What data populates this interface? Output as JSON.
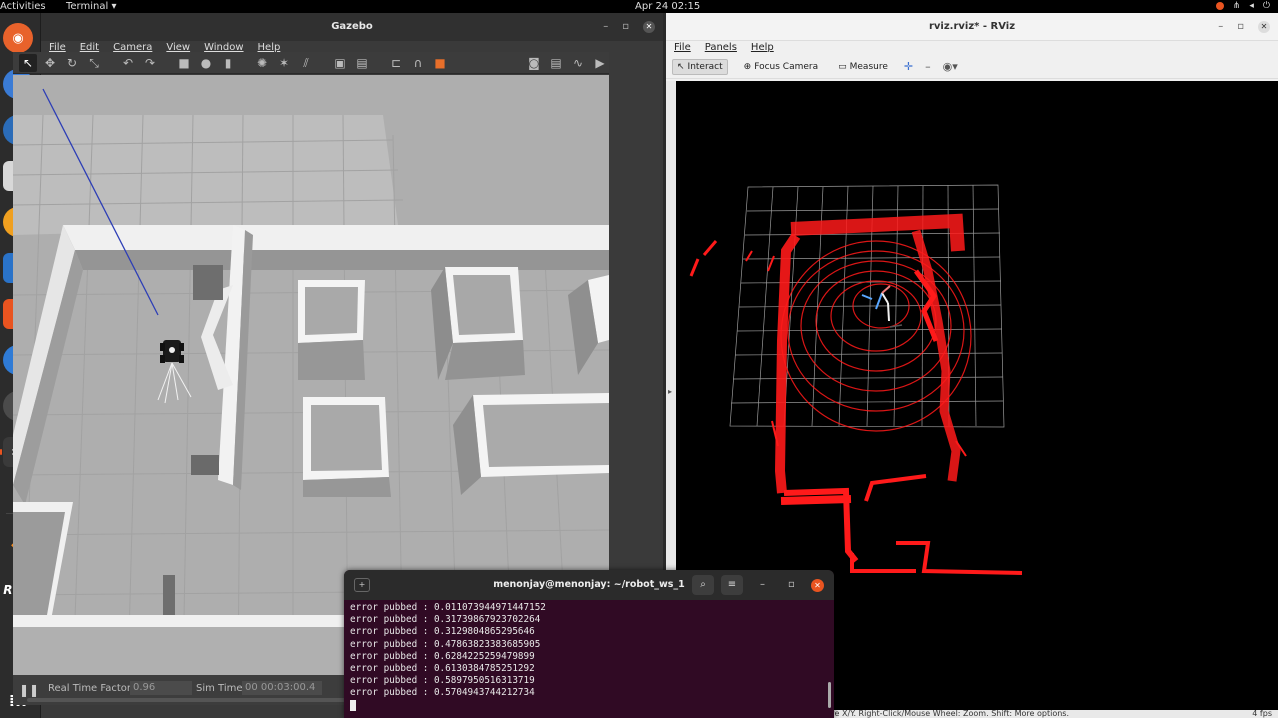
{
  "topbar": {
    "activities": "Activities",
    "app_menu": "Terminal ▾",
    "clock": "Apr 24  02:15",
    "tray_icons": [
      "network-icon",
      "volume-icon",
      "power-icon"
    ]
  },
  "dock": {
    "items": [
      {
        "name": "firefox-icon",
        "color": "#e8622b"
      },
      {
        "name": "chromium-icon",
        "color": "#3a7bd5"
      },
      {
        "name": "thunderbird-icon",
        "color": "#2b6cb8"
      },
      {
        "name": "files-icon",
        "color": "#d8d8d8"
      },
      {
        "name": "rhythmbox-icon",
        "color": "#f0a020"
      },
      {
        "name": "writer-icon",
        "color": "#2a73c9"
      },
      {
        "name": "software-icon",
        "color": "#e95420"
      },
      {
        "name": "help-icon",
        "color": "#2f7bd6"
      },
      {
        "name": "updater-icon",
        "color": "#4b4b4b"
      },
      {
        "name": "terminal-icon",
        "color": "#3a3a3a"
      },
      {
        "name": "gazebo-icon",
        "color": "#f28a1e"
      },
      {
        "name": "rviz-icon",
        "color": "#2c2c2c"
      },
      {
        "name": "plotjuggler-icon",
        "color": "#6d4bc9"
      }
    ],
    "rviz_label": "RViz"
  },
  "gazebo": {
    "title": "Gazebo",
    "menu": [
      "File",
      "Edit",
      "Camera",
      "View",
      "Window",
      "Help"
    ],
    "bottom": {
      "rtf_label": "Real Time Factor:",
      "rtf_value": "0.96",
      "sim_label": "Sim Time:",
      "sim_value": "00 00:03:00.4"
    }
  },
  "rviz": {
    "title": "rviz.rviz* - RViz",
    "menu": [
      "File",
      "Panels",
      "Help"
    ],
    "toolbar": {
      "interact": "Interact",
      "focus_camera": "Focus Camera",
      "measure": "Measure"
    },
    "status_text": "Reset    Left-Click: Rotate.  Middle-Click: Move X/Y.  Right-Click/Mouse Wheel: Zoom.  Shift: More options.",
    "fps": "4 fps",
    "laser_color": "#ff1a1a"
  },
  "terminal": {
    "title": "menonjay@menonjay: ~/robot_ws_1",
    "lines": [
      "error pubbed : 0.011073944971447152",
      "error pubbed : 0.31739867923702264",
      "error pubbed : 0.3129804865295646",
      "error pubbed : 0.47863823383685905",
      "error pubbed : 0.6284225259479899",
      "error pubbed : 0.6130384785251292",
      "error pubbed : 0.5897950516313719",
      "error pubbed : 0.5704943744212734"
    ]
  }
}
